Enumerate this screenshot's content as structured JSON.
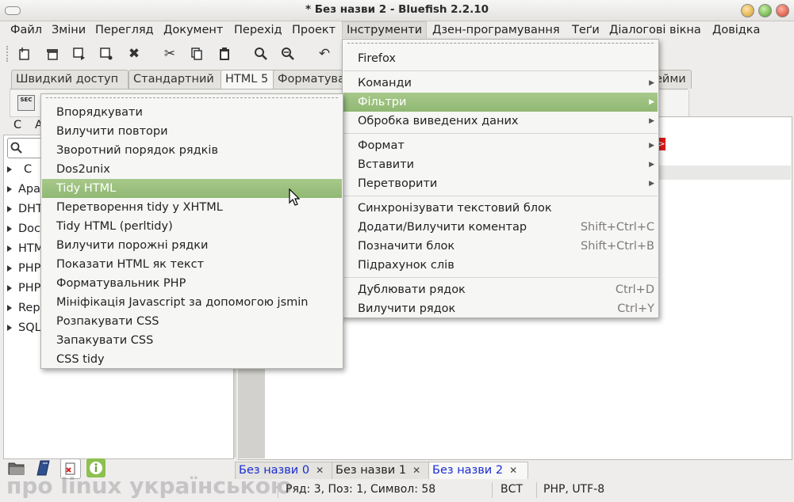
{
  "window": {
    "title": "* Без назви 2 - Bluefish 2.2.10"
  },
  "menubar": {
    "items": [
      "Файл",
      "Зміни",
      "Перегляд",
      "Документ",
      "Перехід",
      "Проект",
      "Інструменти",
      "Дзен-програмування",
      "Теґи",
      "Діалогові вікна",
      "Довідка"
    ]
  },
  "toolbar": {
    "icons": [
      "new-file-icon",
      "open-icon",
      "save-icon",
      "save-as-icon",
      "close-icon",
      "cut-icon",
      "copy-icon",
      "paste-icon",
      "find-icon",
      "find-replace-icon",
      "undo-icon"
    ]
  },
  "tabs": [
    "Швидкий доступ",
    "Стандартний",
    "HTML 5",
    "Форматування",
    "ейми"
  ],
  "htmlbar": {
    "sec_label": "SEC"
  },
  "sidepanel": {
    "tabs": [
      "С",
      "А"
    ],
    "tree": [
      "С",
      "Apa",
      "DHT",
      "Doc",
      "HTM",
      "PHP",
      "PHP",
      "Rep",
      "SQL"
    ]
  },
  "menus": {
    "tools": {
      "items": [
        {
          "label": "Firefox"
        },
        {
          "label": "Команди",
          "submenu": true
        },
        {
          "label": "Фільтри",
          "submenu": true,
          "highlighted": true
        },
        {
          "label": "Обробка виведених даних",
          "submenu": true
        },
        {
          "label": "Формат",
          "submenu": true
        },
        {
          "label": "Вставити",
          "submenu": true
        },
        {
          "label": "Перетворити",
          "submenu": true
        },
        {
          "label": "Синхронізувати текстовий блок"
        },
        {
          "label": "Додати/Вилучити коментар",
          "accel": "Shift+Ctrl+C"
        },
        {
          "label": "Позначити блок",
          "accel": "Shift+Ctrl+B"
        },
        {
          "label": "Підрахунок слів"
        },
        {
          "label": "Дублювати рядок",
          "accel": "Ctrl+D"
        },
        {
          "label": "Вилучити рядок",
          "accel": "Ctrl+Y"
        }
      ]
    },
    "filters": {
      "items": [
        "Впорядкувати",
        "Вилучити повтори",
        "Зворотний порядок рядків",
        "Dos2unix",
        "Tidy HTML",
        "Перетворення tidy у XHTML",
        "Tidy HTML (perltidy)",
        "Вилучити порожні рядки",
        "Показати HTML як текст",
        "Форматувальник PHP",
        "Мініфікація Javascript за допомогою jsmin",
        "Розпакувати CSS",
        "Запакувати CSS",
        "CSS tidy"
      ],
      "highlighted": "Tidy HTML"
    }
  },
  "doc_tabs": [
    {
      "label": "Без назви 0",
      "selected": false,
      "blue": true
    },
    {
      "label": "Без назви 1",
      "selected": false,
      "blue": false
    },
    {
      "label": "Без назви 2",
      "selected": true,
      "blue": true
    }
  ],
  "statusbar": {
    "position": "Ряд: 3, Поз: 1, Символ: 58",
    "mode": "ВСТ",
    "encoding": "PHP, UTF-8"
  },
  "watermark": "про linux українською",
  "colors": {
    "highlight": "#9cbf7f",
    "active_link": "#1a2cd0",
    "error_mark": "#e01818"
  }
}
